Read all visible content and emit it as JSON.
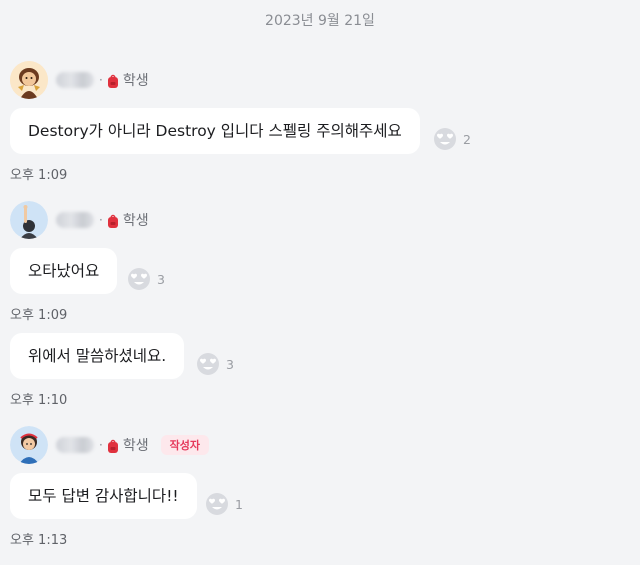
{
  "date_separator": "2023년 9월 21일",
  "messages": [
    {
      "role": "학생",
      "text": "Destory가 아니라 Destroy 입니다 스펠링 주의해주세요",
      "reaction_count": "2",
      "time": "오후 1:09"
    },
    {
      "role": "학생",
      "text": "오타났어요",
      "reaction_count": "3",
      "time": "오후 1:09"
    },
    {
      "text": "위에서 말씀하셨네요.",
      "reaction_count": "3",
      "time": "오후 1:10"
    },
    {
      "role": "학생",
      "author_badge": "작성자",
      "text": "모두 답변 감사합니다!!",
      "reaction_count": "1",
      "time": "오후 1:13"
    }
  ],
  "separator_dot": "·",
  "icons": {
    "reaction": "heart-eyes-emoji-icon",
    "role": "red-backpack-icon"
  },
  "colors": {
    "background": "#f3f4f6",
    "bubble": "#ffffff",
    "badge_bg": "#fde8ec",
    "badge_text": "#e5385a",
    "role_icon": "#e0313e"
  }
}
